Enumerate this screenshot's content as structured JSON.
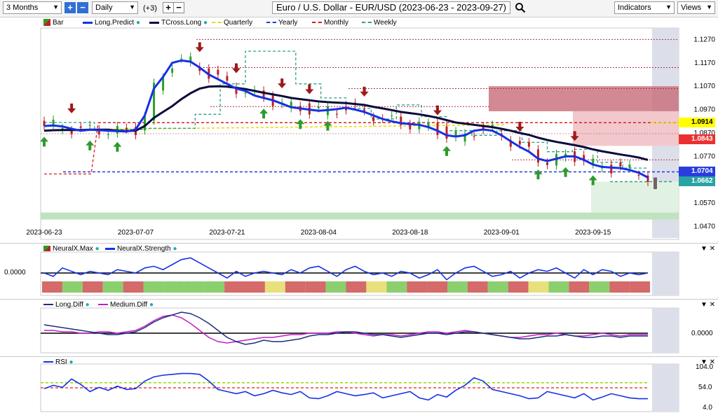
{
  "toolbar": {
    "range_value": "3 Months",
    "interval_value": "Daily",
    "count_label": "(+3)",
    "title": "Euro / U.S. Dollar - EUR/USD (2023-06-23 - 2023-09-27)",
    "indicators_label": "Indicators",
    "views_label": "Views"
  },
  "price_legend": [
    {
      "label": "Bar",
      "color": "#27a827"
    },
    {
      "label": "Long.Predict",
      "color": "#1531e6"
    },
    {
      "label": "TCross.Long",
      "color": "#0a0a3c"
    },
    {
      "label": "Quarterly",
      "color": "#e0e000"
    },
    {
      "label": "Yearly",
      "color": "#1e3cdc"
    },
    {
      "label": "Monthly",
      "color": "#dc1e1e"
    },
    {
      "label": "Weekly",
      "color": "#2aa08a"
    }
  ],
  "price_tags": [
    {
      "label": "1.0914",
      "color": "#ffff00",
      "value": 1.0914,
      "text_color": "#000000"
    },
    {
      "label": "1.0843",
      "color": "#ec3030",
      "value": 1.0843,
      "text_color": "#ffffff"
    },
    {
      "label": "1.0704",
      "color": "#2a3ce0",
      "value": 1.0704,
      "text_color": "#ffffff"
    },
    {
      "label": "1.0662",
      "color": "#2aa3a3",
      "value": 1.0662,
      "text_color": "#ffffff"
    }
  ],
  "neural_legend": [
    {
      "label": "NeuralX.Max",
      "color": "#2aa02a"
    },
    {
      "label": "NeuralX.Strength",
      "color": "#1531e6"
    }
  ],
  "diff_legend": [
    {
      "label": "Long.Diff",
      "color": "#1c2f80"
    },
    {
      "label": "Medium.Diff",
      "color": "#c21ec8"
    }
  ],
  "rsi_legend": [
    {
      "label": "RSI",
      "color": "#1531e6"
    }
  ],
  "chart_data": [
    {
      "type": "line",
      "x_tick_labels": [
        "2023-06-23",
        "2023-07-07",
        "2023-07-21",
        "2023-08-04",
        "2023-08-18",
        "2023-09-01",
        "2023-09-15"
      ],
      "y_tick_labels": [
        "1.1270",
        "1.1170",
        "1.1070",
        "1.0970",
        "1.0870",
        "1.0770",
        "1.0670",
        "1.0570",
        "1.0470"
      ],
      "ylim": [
        1.043,
        1.131
      ],
      "x": [
        "2023-06-23",
        "2023-06-26",
        "2023-06-27",
        "2023-06-28",
        "2023-06-29",
        "2023-06-30",
        "2023-07-03",
        "2023-07-04",
        "2023-07-05",
        "2023-07-06",
        "2023-07-07",
        "2023-07-10",
        "2023-07-11",
        "2023-07-12",
        "2023-07-13",
        "2023-07-14",
        "2023-07-17",
        "2023-07-18",
        "2023-07-19",
        "2023-07-20",
        "2023-07-21",
        "2023-07-24",
        "2023-07-25",
        "2023-07-26",
        "2023-07-27",
        "2023-07-28",
        "2023-07-31",
        "2023-08-01",
        "2023-08-02",
        "2023-08-03",
        "2023-08-04",
        "2023-08-07",
        "2023-08-08",
        "2023-08-09",
        "2023-08-10",
        "2023-08-11",
        "2023-08-14",
        "2023-08-15",
        "2023-08-16",
        "2023-08-17",
        "2023-08-18",
        "2023-08-21",
        "2023-08-22",
        "2023-08-23",
        "2023-08-24",
        "2023-08-25",
        "2023-08-28",
        "2023-08-29",
        "2023-08-30",
        "2023-08-31",
        "2023-09-01",
        "2023-09-04",
        "2023-09-05",
        "2023-09-06",
        "2023-09-07",
        "2023-09-08",
        "2023-09-11",
        "2023-09-12",
        "2023-09-13",
        "2023-09-14",
        "2023-09-15",
        "2023-09-18",
        "2023-09-19",
        "2023-09-20",
        "2023-09-21",
        "2023-09-22",
        "2023-09-25"
      ],
      "series": [
        {
          "name": "Long.Predict",
          "values": [
            1.09,
            1.0902,
            1.0898,
            1.0888,
            1.088,
            1.0884,
            1.0882,
            1.088,
            1.0878,
            1.0876,
            1.0885,
            1.0945,
            1.106,
            1.111,
            1.117,
            1.118,
            1.1175,
            1.115,
            1.112,
            1.11,
            1.108,
            1.106,
            1.105,
            1.103,
            1.102,
            1.101,
            1.0995,
            1.098,
            1.0975,
            1.097,
            1.0965,
            1.0968,
            1.0972,
            1.0978,
            1.097,
            1.096,
            1.0945,
            1.093,
            1.092,
            1.0912,
            1.0908,
            1.0905,
            1.0895,
            1.088,
            1.086,
            1.0855,
            1.086,
            1.088,
            1.0885,
            1.088,
            1.086,
            1.0835,
            1.081,
            1.079,
            1.076,
            1.075,
            1.076,
            1.077,
            1.077,
            1.0755,
            1.0735,
            1.0725,
            1.0722,
            1.072,
            1.0712,
            1.07,
            1.068
          ]
        },
        {
          "name": "TCross.Long",
          "values": [
            1.088,
            1.0882,
            1.0883,
            1.0883,
            1.0883,
            1.0884,
            1.0884,
            1.0884,
            1.088,
            1.0878,
            1.088,
            1.09,
            1.0935,
            1.096,
            1.0985,
            1.1015,
            1.104,
            1.106,
            1.1068,
            1.107,
            1.1068,
            1.1063,
            1.1058,
            1.105,
            1.1042,
            1.1035,
            1.1028,
            1.102,
            1.1015,
            1.101,
            1.1005,
            1.1002,
            1.1,
            1.0998,
            1.0994,
            1.099,
            1.0982,
            1.0975,
            1.0968,
            1.096,
            1.0955,
            1.095,
            1.0943,
            1.0935,
            1.0925,
            1.0915,
            1.091,
            1.0905,
            1.09,
            1.0895,
            1.0888,
            1.088,
            1.087,
            1.0862,
            1.085,
            1.084,
            1.0832,
            1.0825,
            1.0818,
            1.081,
            1.08,
            1.0792,
            1.0785,
            1.0778,
            1.0772,
            1.0765,
            1.0755
          ]
        }
      ]
    },
    {
      "type": "line",
      "y_tick_labels": [
        "0.0000"
      ],
      "ylim": [
        -1,
        1
      ],
      "series": [
        {
          "name": "NeuralX.Strength",
          "values": [
            0.0,
            -0.2,
            0.3,
            0.1,
            -0.1,
            0.1,
            0.0,
            -0.1,
            0.2,
            0.1,
            0.0,
            0.3,
            0.4,
            0.2,
            0.5,
            0.8,
            0.9,
            0.6,
            0.3,
            0.0,
            -0.3,
            0.1,
            -0.2,
            0.0,
            0.1,
            0.0,
            -0.1,
            0.2,
            0.0,
            0.3,
            0.4,
            0.1,
            -0.2,
            0.2,
            0.4,
            0.1,
            -0.1,
            0.0,
            -0.2,
            0.1,
            0.0,
            -0.3,
            -0.1,
            0.2,
            -0.4,
            0.0,
            0.3,
            0.4,
            0.1,
            -0.2,
            -0.1,
            0.1,
            -0.3,
            0.0,
            0.2,
            0.1,
            0.3,
            0.0,
            -0.3,
            0.2,
            -0.1,
            0.2,
            0.1,
            -0.2,
            0.0,
            -0.1,
            0.0
          ]
        }
      ]
    },
    {
      "type": "line",
      "y_tick_labels": [
        "0.0000"
      ],
      "ylim": [
        -1,
        1
      ],
      "series": [
        {
          "name": "Long.Diff",
          "values": [
            0.3,
            0.25,
            0.2,
            0.15,
            0.1,
            0.05,
            0.0,
            -0.05,
            -0.05,
            0.0,
            0.05,
            0.2,
            0.4,
            0.55,
            0.65,
            0.75,
            0.7,
            0.55,
            0.35,
            0.1,
            -0.15,
            -0.3,
            -0.4,
            -0.35,
            -0.25,
            -0.3,
            -0.3,
            -0.25,
            -0.2,
            -0.1,
            -0.05,
            -0.05,
            0.0,
            0.05,
            0.05,
            0.0,
            -0.05,
            -0.05,
            -0.1,
            -0.15,
            -0.1,
            -0.05,
            0.0,
            0.0,
            -0.05,
            0.0,
            0.05,
            0.05,
            0.0,
            -0.05,
            -0.1,
            -0.15,
            -0.2,
            -0.2,
            -0.15,
            -0.1,
            -0.1,
            -0.05,
            -0.1,
            -0.15,
            -0.15,
            -0.1,
            -0.1,
            -0.15,
            -0.1,
            -0.1,
            -0.1
          ]
        },
        {
          "name": "Medium.Diff",
          "values": [
            0.1,
            0.1,
            0.05,
            0.05,
            0.0,
            0.0,
            0.05,
            0.05,
            0.0,
            0.05,
            0.1,
            0.25,
            0.45,
            0.6,
            0.65,
            0.55,
            0.35,
            0.1,
            -0.15,
            -0.3,
            -0.35,
            -0.3,
            -0.25,
            -0.2,
            -0.15,
            -0.15,
            -0.1,
            -0.05,
            -0.05,
            0.0,
            0.0,
            0.0,
            0.05,
            0.05,
            0.0,
            -0.05,
            -0.1,
            -0.05,
            -0.05,
            -0.1,
            -0.05,
            0.0,
            0.05,
            0.05,
            0.0,
            0.05,
            0.1,
            0.05,
            0.0,
            -0.05,
            -0.1,
            -0.15,
            -0.15,
            -0.1,
            -0.05,
            -0.05,
            0.0,
            -0.05,
            -0.1,
            -0.1,
            -0.05,
            0.0,
            -0.05,
            -0.1,
            -0.05,
            -0.05,
            -0.05
          ]
        }
      ]
    },
    {
      "type": "line",
      "y_tick_labels": [
        "104.0",
        "54.0",
        "4.0"
      ],
      "ylim": [
        4,
        104
      ],
      "series": [
        {
          "name": "RSI",
          "values": [
            52,
            60,
            55,
            75,
            62,
            45,
            55,
            48,
            58,
            50,
            52,
            70,
            80,
            84,
            86,
            88,
            88,
            86,
            70,
            50,
            45,
            40,
            45,
            35,
            40,
            48,
            42,
            38,
            45,
            30,
            28,
            35,
            45,
            40,
            35,
            38,
            42,
            30,
            35,
            40,
            45,
            30,
            25,
            38,
            32,
            48,
            60,
            78,
            70,
            50,
            45,
            40,
            35,
            28,
            30,
            45,
            40,
            35,
            30,
            40,
            25,
            32,
            40,
            35,
            30,
            28,
            28
          ]
        }
      ]
    }
  ]
}
